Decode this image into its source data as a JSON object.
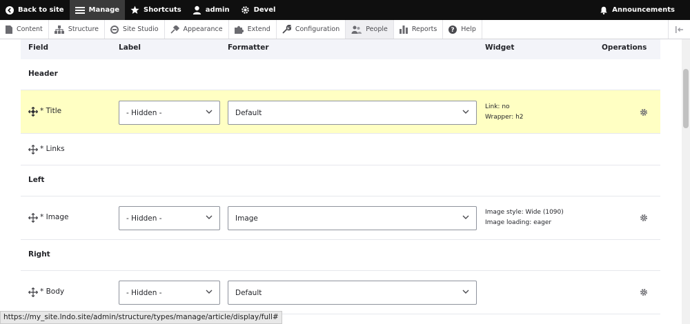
{
  "toolbar": {
    "back_label": "Back to site",
    "manage_label": "Manage",
    "shortcuts_label": "Shortcuts",
    "user_label": "admin",
    "devel_label": "Devel",
    "announcements_label": "Announcements"
  },
  "tray": {
    "items": [
      {
        "label": "Content",
        "icon": "content-icon"
      },
      {
        "label": "Structure",
        "icon": "structure-icon"
      },
      {
        "label": "Site Studio",
        "icon": "site-studio-icon"
      },
      {
        "label": "Appearance",
        "icon": "appearance-icon"
      },
      {
        "label": "Extend",
        "icon": "extend-icon"
      },
      {
        "label": "Configuration",
        "icon": "wrench-icon"
      },
      {
        "label": "People",
        "icon": "people-icon"
      },
      {
        "label": "Reports",
        "icon": "reports-icon"
      },
      {
        "label": "Help",
        "icon": "help-icon"
      }
    ]
  },
  "table": {
    "headers": {
      "field": "Field",
      "label": "Label",
      "formatter": "Formatter",
      "widget": "Widget",
      "operations": "Operations"
    },
    "regions": {
      "header": "Header",
      "left": "Left",
      "right": "Right"
    },
    "rows": {
      "title": {
        "name": "Title",
        "label_value": "- Hidden -",
        "formatter_value": "Default",
        "summary_1": "Link: no",
        "summary_2": "Wrapper: h2"
      },
      "links": {
        "name": "Links"
      },
      "image": {
        "name": "Image",
        "label_value": "- Hidden -",
        "formatter_value": "Image",
        "summary_1": "Image style: Wide (1090)",
        "summary_2": "Image loading: eager"
      },
      "body": {
        "name": "Body",
        "label_value": "- Hidden -",
        "formatter_value": "Default"
      }
    },
    "required_marker": "*"
  },
  "status_url": "https://my_site.lndo.site/admin/structure/types/manage/article/display/full#",
  "colors": {
    "toolbar_bg": "#0f0f0f",
    "highlight_row": "#ffffc3",
    "table_head_bg": "#f3f4f9"
  }
}
